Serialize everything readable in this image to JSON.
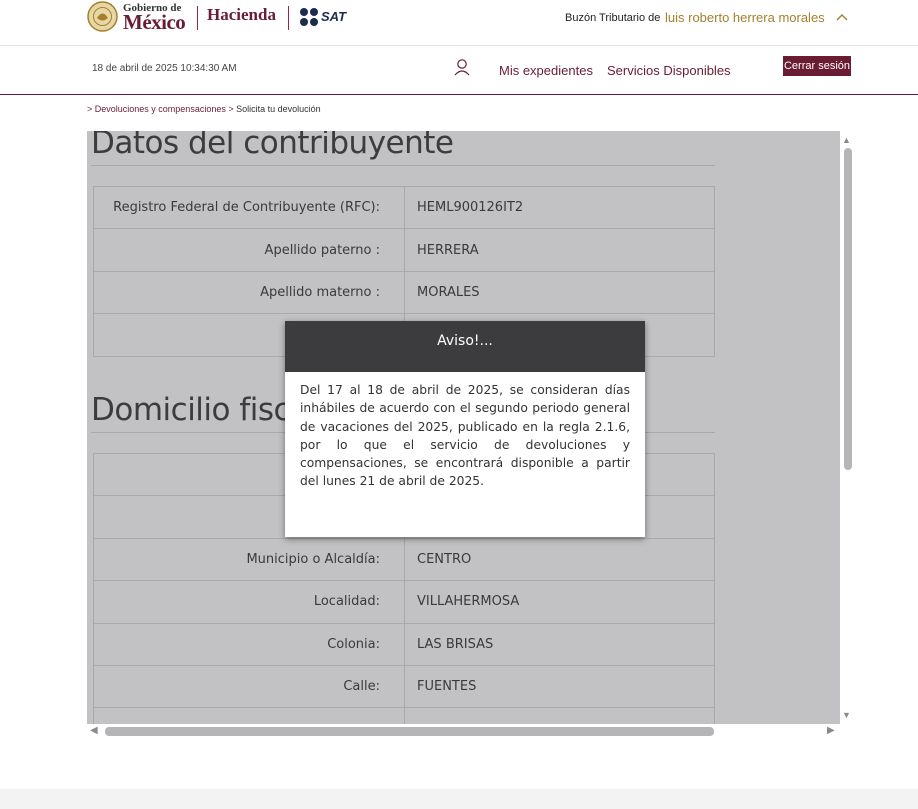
{
  "header": {
    "logo_gobierno_top": "Gobierno de",
    "logo_gobierno_main": "México",
    "logo_hacienda": "Hacienda",
    "logo_sat": "SAT",
    "buzon_label": "Buzón Tributario de",
    "user_name": "luis roberto herrera morales",
    "chevron_icon": "chevron-up-icon"
  },
  "nav": {
    "datetime": "18 de abril de 2025 10:34:30 AM",
    "user_icon": "user-icon",
    "link_expedientes": "Mis expedientes",
    "link_servicios": "Servicios Disponibles",
    "logout": "Cerrar sesión"
  },
  "breadcrumb": {
    "prefix": "> ",
    "parent": "Devoluciones y compensaciones",
    "sep": " > ",
    "current": "Solicita tu devolución"
  },
  "contribuyente": {
    "title": "Datos del contribuyente",
    "rows": [
      {
        "label": "Registro Federal de Contribuyente (RFC):",
        "value": "HEML900126IT2"
      },
      {
        "label": "Apellido paterno :",
        "value": "HERRERA"
      },
      {
        "label": "Apellido materno :",
        "value": "MORALES"
      },
      {
        "label": "",
        "value": ""
      }
    ]
  },
  "domicilio": {
    "title": "Domicilio fiscal",
    "rows": [
      {
        "label": "",
        "value": ""
      },
      {
        "label": "",
        "value": ""
      },
      {
        "label": "Municipio o Alcaldía:",
        "value": "CENTRO"
      },
      {
        "label": "Localidad:",
        "value": "VILLAHERMOSA"
      },
      {
        "label": "Colonia:",
        "value": "LAS BRISAS"
      },
      {
        "label": "Calle:",
        "value": "FUENTES"
      },
      {
        "label": "",
        "value": ""
      }
    ]
  },
  "modal": {
    "title": "Aviso!...",
    "body": "Del 17 al 18 de abril de 2025, se consideran días inhábiles de acuerdo con el segundo periodo general de vacaciones del 2025, publicado en la regla 2.1.6, por lo que el servicio de devoluciones y compensaciones, se encontrará disponible a partir del lunes 21 de abril de 2025."
  },
  "colors": {
    "brand": "#691c32",
    "gold": "#a57f2c",
    "overlay": "#c2c2c4",
    "modal_header": "#3c3c3e"
  }
}
